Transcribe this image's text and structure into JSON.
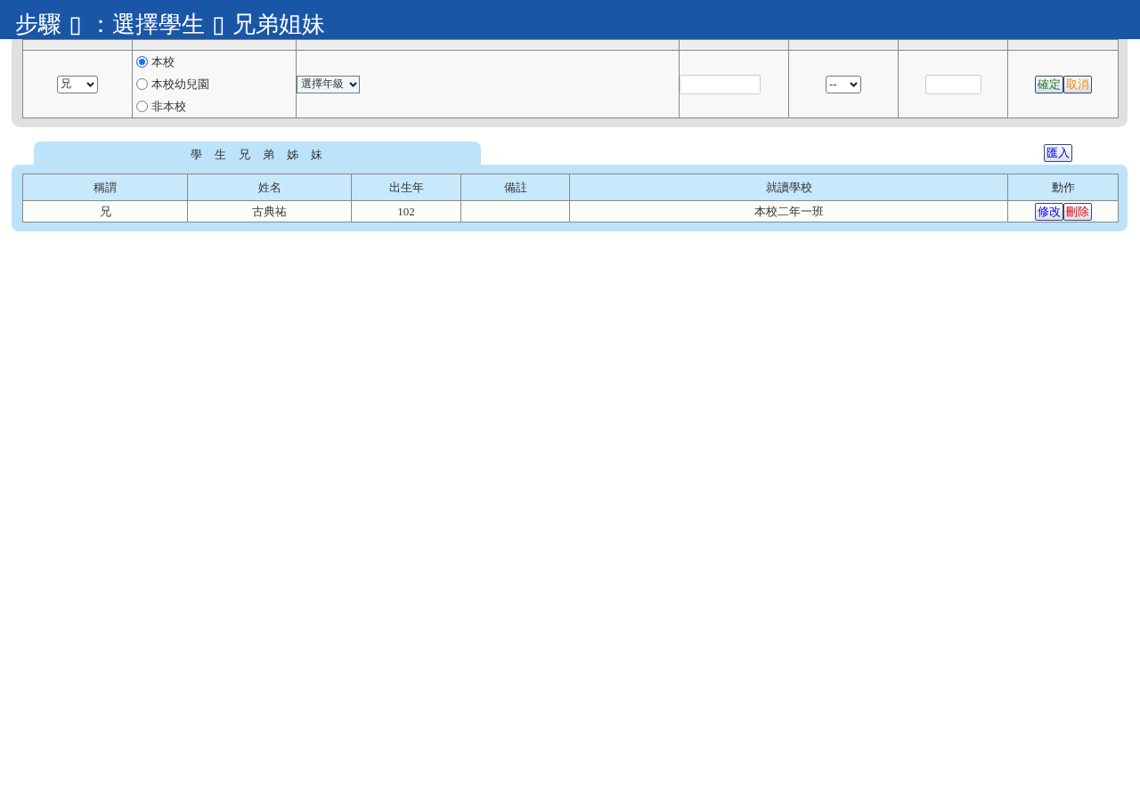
{
  "title": "步驟 ▯ ：選擇學生 ▯ 兄弟姐妹",
  "form": {
    "relation_select": {
      "value": "兄"
    },
    "category_options": [
      {
        "label": "本校",
        "selected": true
      },
      {
        "label": "本校幼兒園",
        "selected": false
      },
      {
        "label": "非本校",
        "selected": false
      }
    ],
    "grade_select": {
      "value": "選擇年級"
    },
    "birth_year_select": {
      "value": "--"
    },
    "buttons": [
      {
        "label": "確定",
        "kind": "confirm"
      },
      {
        "label": "取消",
        "kind": "cancel"
      }
    ]
  },
  "siblings": {
    "tab": "學 生 兄 弟 姊 妹",
    "import_button": "匯入",
    "columns": [
      "稱謂",
      "姓名",
      "出生年",
      "備註",
      "就讀學校",
      "動作"
    ],
    "rows": [
      {
        "relation": "兄",
        "name": "古典祐",
        "birth_year": "102",
        "school": "本校二年一班",
        "actions": [
          {
            "label": "修改",
            "kind": "edit"
          },
          {
            "label": "刪除",
            "kind": "delete"
          }
        ]
      }
    ]
  }
}
